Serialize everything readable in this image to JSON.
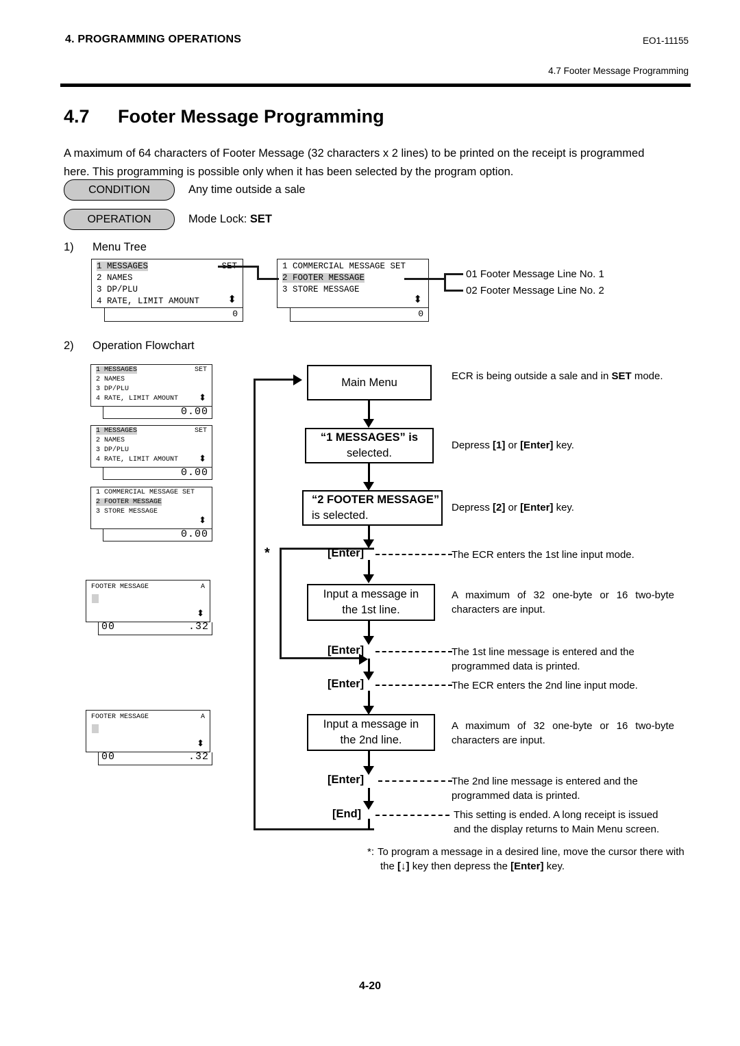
{
  "header": {
    "chapter": "4. PROGRAMMING OPERATIONS",
    "doc_code": "EO1-11155",
    "section_ref": "4.7 Footer Message Programming"
  },
  "title": {
    "number": "4.7",
    "text": "Footer Message Programming"
  },
  "intro": "A maximum of 64 characters of Footer Message (32 characters x 2 lines) to be printed on the receipt is programmed here.  This programming is possible only when it has been selected by the program option.",
  "condition": {
    "label": "CONDITION",
    "value": "Any time outside a sale"
  },
  "operation": {
    "label": "OPERATION",
    "value_prefix": "Mode Lock: ",
    "value_bold": "SET"
  },
  "sections": {
    "menu_tree": {
      "num": "1)",
      "label": "Menu Tree"
    },
    "flowchart": {
      "num": "2)",
      "label": "Operation Flowchart"
    }
  },
  "menu_tree": {
    "panel1": {
      "rows": [
        "1 MESSAGES",
        "2 NAMES",
        "3 DP/PLU",
        "4 RATE, LIMIT AMOUNT"
      ],
      "right_tag": "SET",
      "scroll_icon": "up-down-arrow-icon",
      "status_value": "0"
    },
    "panel2": {
      "rows": [
        "1 COMMERCIAL MESSAGE SET",
        "2 FOOTER MESSAGE",
        "3 STORE MESSAGE"
      ],
      "scroll_icon": "up-down-arrow-icon",
      "status_value": "0"
    },
    "leaves": [
      "01 Footer Message Line No. 1",
      "02 Footer Message Line No. 2"
    ]
  },
  "lcd_panels": [
    {
      "rows": [
        "1 MESSAGES",
        "2 NAMES",
        "3 DP/PLU",
        "4 RATE, LIMIT AMOUNT"
      ],
      "right_tag": "SET",
      "status_right": "0.00"
    },
    {
      "rows": [
        "1 MESSAGES",
        "2 NAMES",
        "3 DP/PLU",
        "4 RATE, LIMIT AMOUNT"
      ],
      "right_tag": "SET",
      "status_right": "0.00"
    },
    {
      "rows": [
        "1 COMMERCIAL MESSAGE SET",
        "2 FOOTER MESSAGE",
        "3 STORE MESSAGE"
      ],
      "right_tag": "",
      "status_right": "0.00"
    },
    {
      "title": "FOOTER MESSAGE",
      "mode_indicator": "A",
      "status_left": "00",
      "status_right": ".32"
    },
    {
      "title": "FOOTER MESSAGE",
      "mode_indicator": "A",
      "status_left": "00",
      "status_right": ".32"
    }
  ],
  "flow": {
    "box_main_menu": "Main Menu",
    "box_messages_l1": "“1 MESSAGES” is",
    "box_messages_l2": "selected.",
    "box_footer_l1": "“2 FOOTER MESSAGE”",
    "box_footer_l2": "is selected.",
    "box_input1_l1": "Input a message in",
    "box_input1_l2": "the 1st line.",
    "box_input2_l1": "Input a message in",
    "box_input2_l2": "the 2nd line.",
    "key_enter": "[Enter]",
    "key_end": "[End]",
    "star": "*"
  },
  "notes": {
    "n1_pre": "ECR is being outside a sale and in ",
    "n1_bold": "SET",
    "n1_post": " mode.",
    "n2_pre": "Depress ",
    "n2_b1": "[1]",
    "n2_mid": " or ",
    "n2_b2": "[Enter]",
    "n2_post": " key.",
    "n3_pre": "Depress ",
    "n3_b1": "[2]",
    "n3_mid": " or ",
    "n3_b2": "[Enter]",
    "n3_post": " key.",
    "n4": "The ECR enters the 1st line input mode.",
    "n5": "A maximum of 32 one-byte or 16 two-byte characters are input.",
    "n6_l1": "The 1st line message is entered and the",
    "n6_l2": "programmed data is printed.",
    "n7": "The ECR enters the 2nd line input mode.",
    "n8": "A maximum of 32 one-byte or 16 two-byte characters are input.",
    "n9_l1": "The 2nd line message is entered and the",
    "n9_l2": "programmed data is printed.",
    "n10_l1": "This setting is ended.  A long receipt is issued",
    "n10_l2": "and the display returns to Main Menu screen."
  },
  "footnote": {
    "marker": "*:",
    "l1": "To program a message in a desired line, move the cursor there with",
    "l2_pre": "the ",
    "l2_b1": "[↓]",
    "l2_mid": " key then depress the ",
    "l2_b2": "[Enter]",
    "l2_post": " key."
  },
  "page_number": "4-20"
}
